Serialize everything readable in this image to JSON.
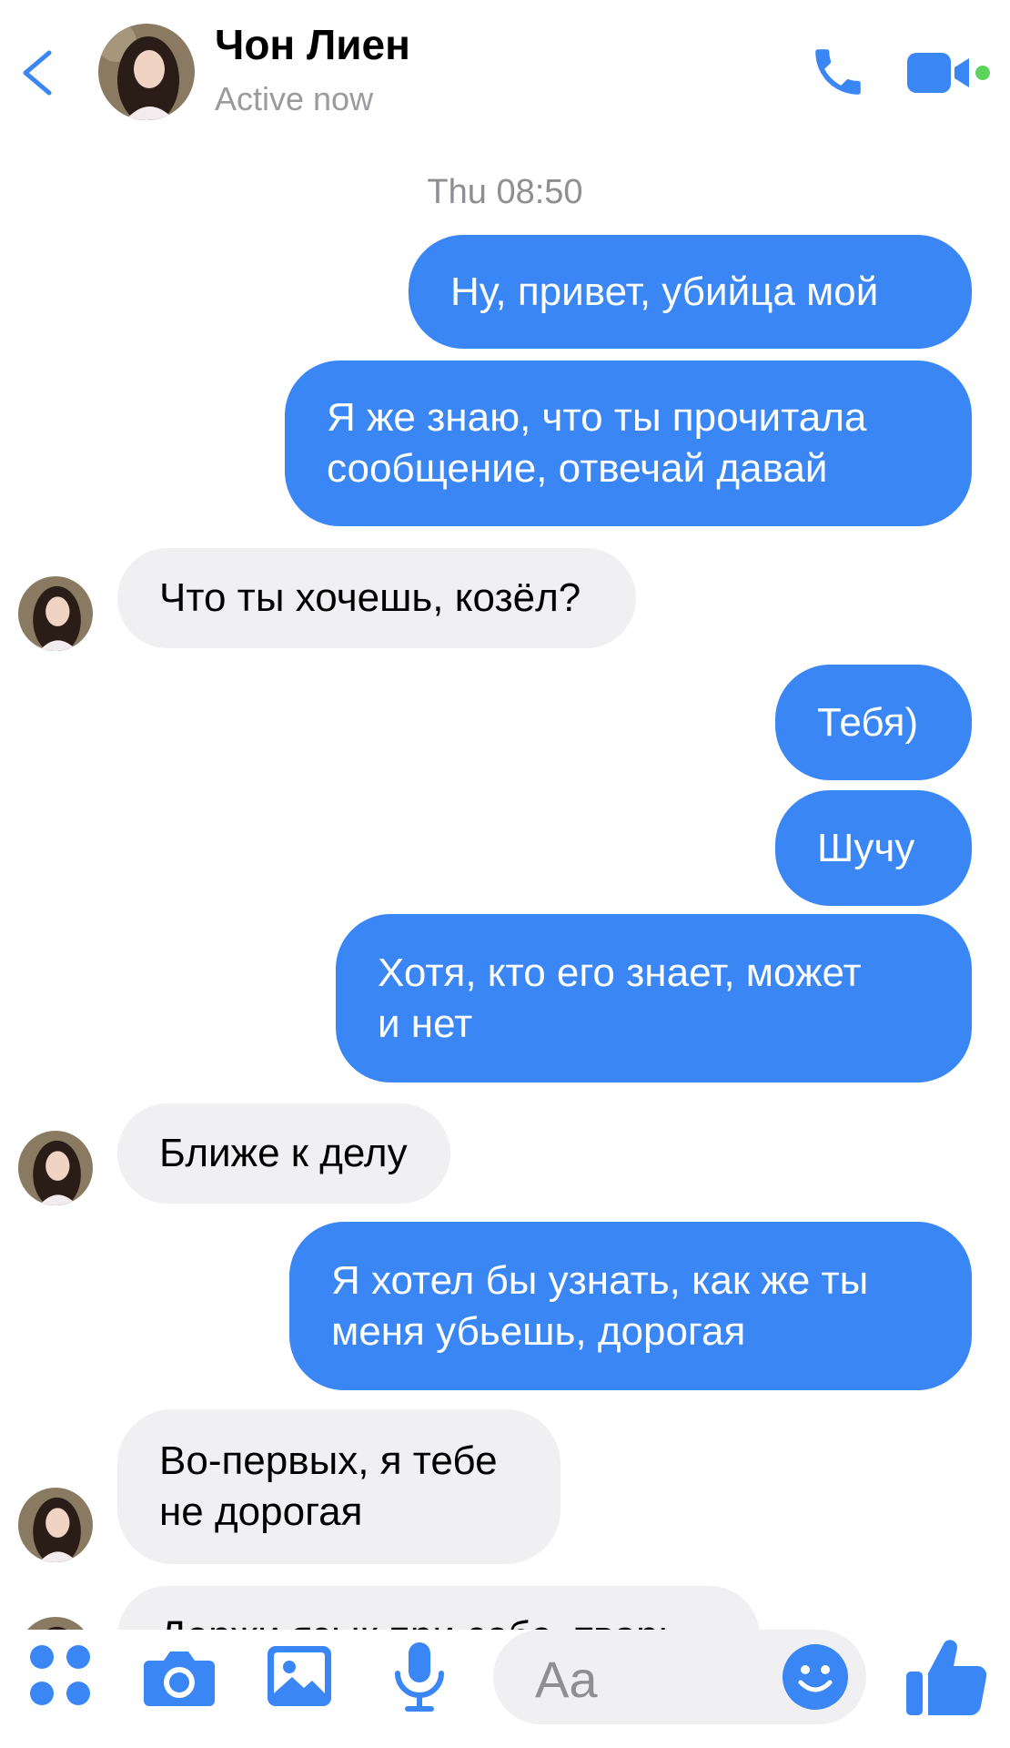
{
  "header": {
    "contact_name": "Чон Лиен",
    "status": "Active now"
  },
  "timestamp": "Thu 08:50",
  "messages": [
    {
      "direction": "outgoing",
      "lines": [
        "Ну, привет, убийца мой"
      ]
    },
    {
      "direction": "outgoing",
      "lines": [
        "Я же знаю, что ты прочитала",
        "сообщение, отвечай давай"
      ]
    },
    {
      "direction": "incoming",
      "lines": [
        "Что ты хочешь, козёл?"
      ]
    },
    {
      "direction": "outgoing",
      "lines": [
        "Тебя)"
      ]
    },
    {
      "direction": "outgoing",
      "lines": [
        "Шучу"
      ]
    },
    {
      "direction": "outgoing",
      "lines": [
        "Хотя, кто его знает, может",
        "и нет"
      ]
    },
    {
      "direction": "incoming",
      "lines": [
        "Ближе к делу"
      ]
    },
    {
      "direction": "outgoing",
      "lines": [
        "Я хотел бы узнать, как же ты",
        "меня убьешь, дорогая"
      ]
    },
    {
      "direction": "incoming",
      "lines": [
        "Во-первых, я тебе",
        "не дорогая"
      ]
    },
    {
      "direction": "incoming",
      "lines": [
        "Держи язык при себе, тварь"
      ]
    }
  ],
  "composer": {
    "placeholder": "Aa",
    "tools": [
      "apps-icon",
      "camera-icon",
      "gallery-icon",
      "microphone-icon"
    ],
    "like_icon": "thumbs-up-icon",
    "emoji_icon": "smiley-icon"
  },
  "colors": {
    "accent": "#3a86f5",
    "incoming_bubble": "#f0f0f2",
    "online_dot": "#5bd45b"
  }
}
